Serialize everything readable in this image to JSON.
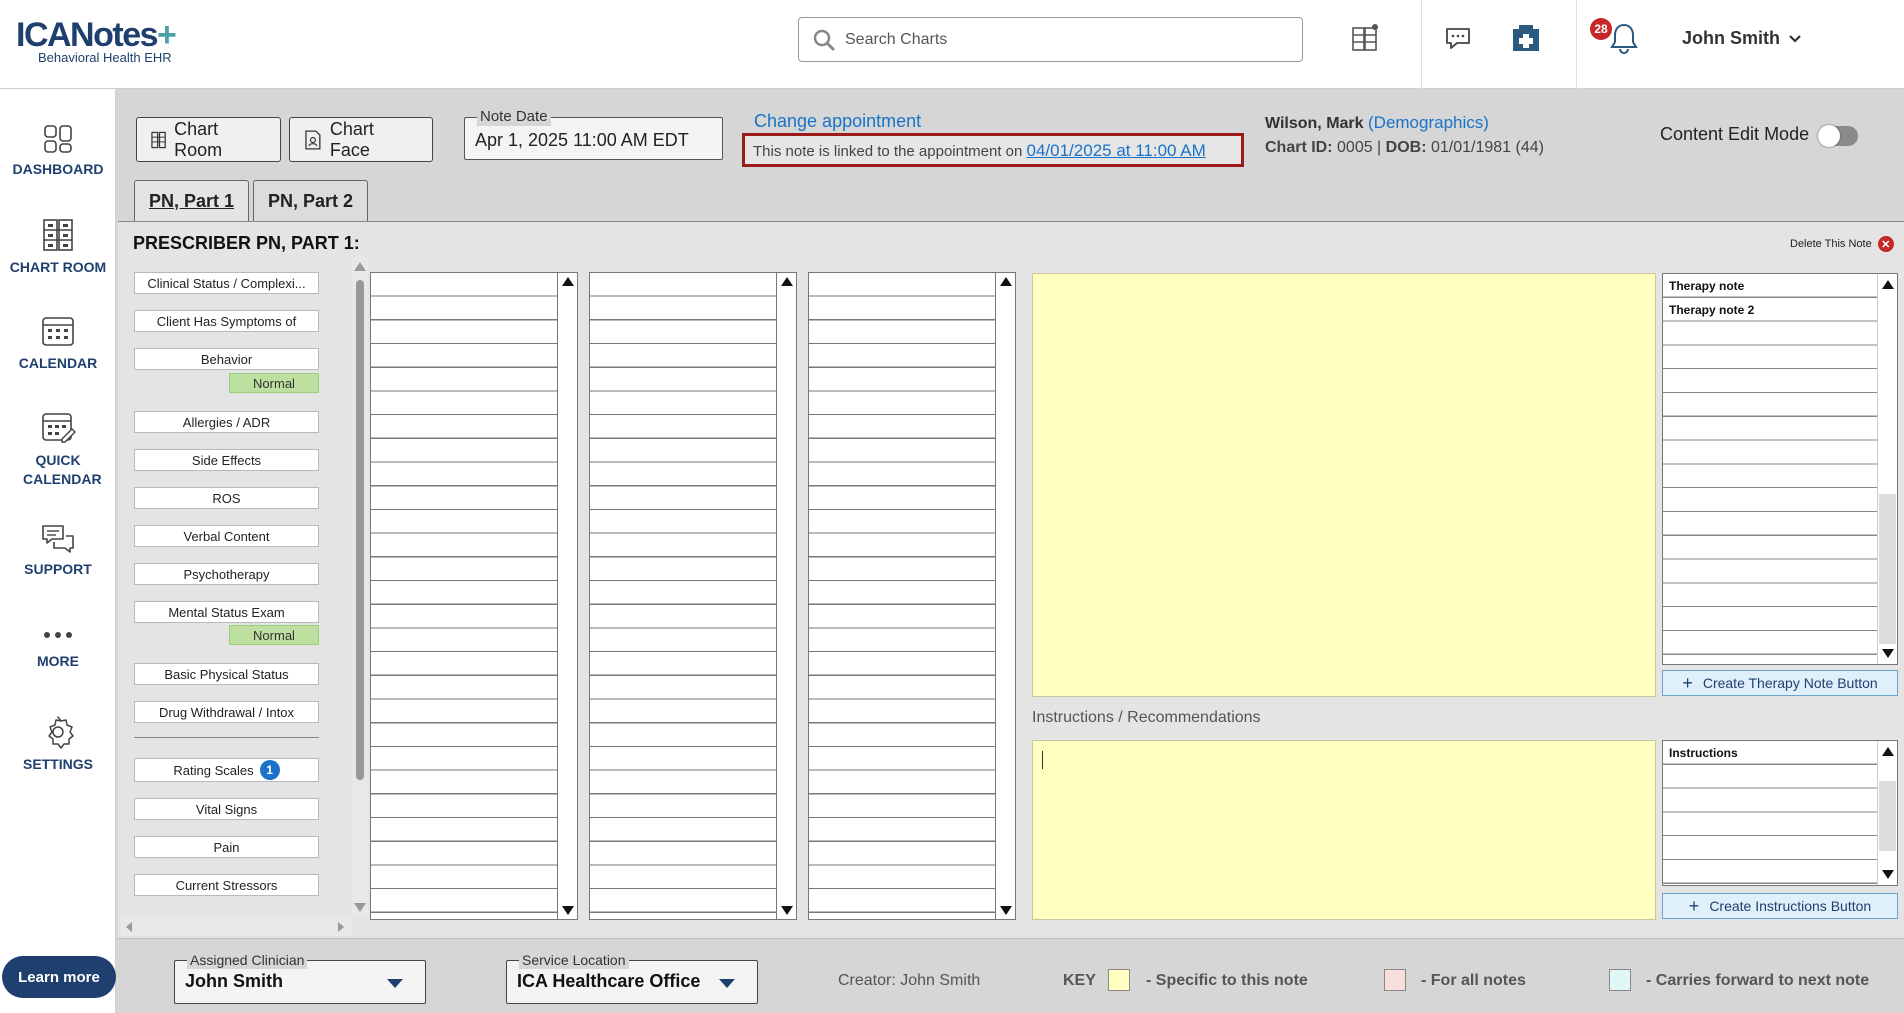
{
  "header": {
    "logo_main": "ICANotes",
    "logo_sub": "Behavioral Health EHR",
    "search_placeholder": "Search Charts",
    "notification_count": "28",
    "user_name": "John Smith"
  },
  "nav": {
    "items": [
      {
        "label": "DASHBOARD",
        "icon": "dashboard-icon"
      },
      {
        "label": "CHART ROOM",
        "icon": "chart-room-icon"
      },
      {
        "label": "CALENDAR",
        "icon": "calendar-icon"
      },
      {
        "label": "QUICK CALENDAR",
        "icon": "quick-calendar-icon"
      },
      {
        "label": "SUPPORT",
        "icon": "support-icon"
      },
      {
        "label": "MORE",
        "icon": "more-icon"
      },
      {
        "label": "SETTINGS",
        "icon": "gear-icon"
      }
    ],
    "learn_more": "Learn more"
  },
  "toolbar": {
    "chart_room": "Chart Room",
    "chart_face": "Chart Face",
    "note_date_label": "Note Date",
    "note_date_value": "Apr 1, 2025 11:00 AM EDT",
    "change_appointment": "Change appointment",
    "linked_text": "This note is linked to the appointment on",
    "linked_date": "04/01/2025 at 11:00 AM",
    "patient_name": "Wilson, Mark",
    "demographics": "(Demographics)",
    "chart_id_label": "Chart ID:",
    "chart_id_value": "0005",
    "dob_label": "DOB:",
    "dob_value": "01/01/1981 (44)",
    "content_edit_mode": "Content Edit Mode"
  },
  "tabs": [
    {
      "label": "PN, Part 1",
      "active": true
    },
    {
      "label": "PN, Part 2",
      "active": false
    }
  ],
  "panel": {
    "title": "PRESCRIBER PN, PART 1:",
    "delete_note": "Delete This Note",
    "sections": [
      "Clinical Status / Complexi...",
      "Client Has Symptoms of",
      "Behavior",
      "Allergies / ADR",
      "Side Effects",
      "ROS",
      "Verbal Content",
      "Psychotherapy",
      "Mental Status Exam",
      "Basic Physical Status",
      "Drug Withdrawal / Intox",
      "Rating Scales",
      "Vital Signs",
      "Pain",
      "Current Stressors"
    ],
    "normal_tag": "Normal",
    "rating_scales_count": "1",
    "instructions_label": "Instructions / Recommendations",
    "therapy_notes": [
      "Therapy note",
      "Therapy note 2"
    ],
    "create_therapy_btn": "Create Therapy Note Button",
    "instructions_list": [
      "Instructions"
    ],
    "create_instructions_btn": "Create Instructions Button"
  },
  "footer": {
    "assigned_clinician_label": "Assigned Clinician",
    "assigned_clinician_value": "John Smith",
    "service_location_label": "Service Location",
    "service_location_value": "ICA Healthcare Office",
    "creator": "Creator: John Smith",
    "key_label": "KEY",
    "key_items": [
      {
        "text": "- Specific to this note",
        "color": "#ffffc0"
      },
      {
        "text": "- For all notes",
        "color": "#f9dede"
      },
      {
        "text": "- Carries forward to next note",
        "color": "#dff7f7"
      }
    ]
  }
}
